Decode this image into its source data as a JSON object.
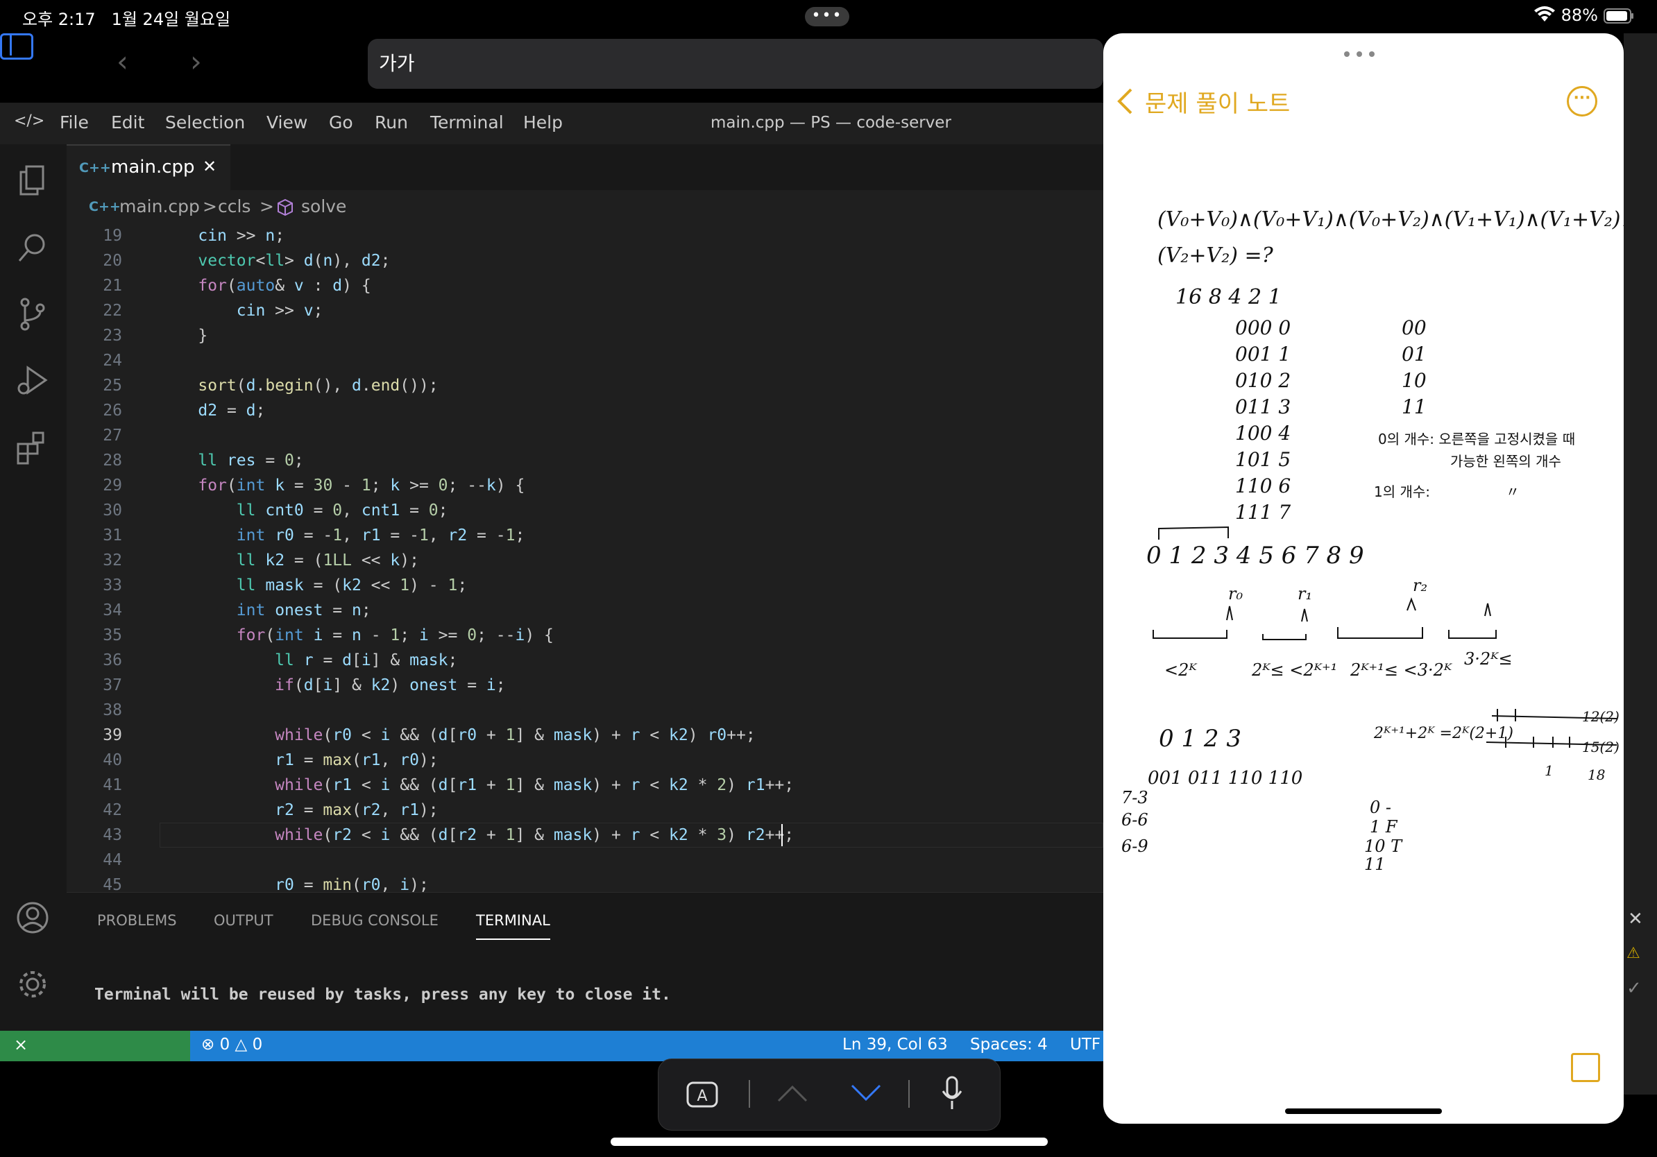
{
  "status_bar": {
    "time": "오후 2:17",
    "date": "1월 24일 월요일",
    "dots": "•••",
    "battery": "88%"
  },
  "safari": {
    "url_text": "가가"
  },
  "vscode": {
    "menu": [
      "File",
      "Edit",
      "Selection",
      "View",
      "Go",
      "Run",
      "Terminal",
      "Help"
    ],
    "window_title": "main.cpp — PS — code-server",
    "tab": {
      "badge": "C++",
      "label": "main.cpp",
      "close": "✕"
    },
    "breadcrumb": {
      "file": "main.cpp",
      "sep": ">",
      "ns": "ccls",
      "symbol": "solve"
    },
    "lines": [
      {
        "n": "19",
        "c": "    cin >> n;"
      },
      {
        "n": "20",
        "c": "    vector<ll> d(n), d2;"
      },
      {
        "n": "21",
        "c": "    for(auto& v : d) {"
      },
      {
        "n": "22",
        "c": "        cin >> v;"
      },
      {
        "n": "23",
        "c": "    }"
      },
      {
        "n": "24",
        "c": ""
      },
      {
        "n": "25",
        "c": "    sort(d.begin(), d.end());"
      },
      {
        "n": "26",
        "c": "    d2 = d;"
      },
      {
        "n": "27",
        "c": ""
      },
      {
        "n": "28",
        "c": "    ll res = 0;"
      },
      {
        "n": "29",
        "c": "    for(int k = 30 - 1; k >= 0; --k) {"
      },
      {
        "n": "30",
        "c": "        ll cnt0 = 0, cnt1 = 0;"
      },
      {
        "n": "31",
        "c": "        int r0 = -1, r1 = -1, r2 = -1;"
      },
      {
        "n": "32",
        "c": "        ll k2 = (1LL << k);"
      },
      {
        "n": "33",
        "c": "        ll mask = (k2 << 1) - 1;"
      },
      {
        "n": "34",
        "c": "        int onest = n;"
      },
      {
        "n": "35",
        "c": "        for(int i = n - 1; i >= 0; --i) {"
      },
      {
        "n": "36",
        "c": "            ll r = d[i] & mask;"
      },
      {
        "n": "37",
        "c": "            if(d[i] & k2) onest = i;"
      },
      {
        "n": "38",
        "c": ""
      },
      {
        "n": "39",
        "c": "            while(r0 < i && (d[r0 + 1] & mask) + r < k2) r0++;"
      },
      {
        "n": "40",
        "c": "            r1 = max(r1, r0);"
      },
      {
        "n": "41",
        "c": "            while(r1 < i && (d[r1 + 1] & mask) + r < k2 * 2) r1++;"
      },
      {
        "n": "42",
        "c": "            r2 = max(r2, r1);"
      },
      {
        "n": "43",
        "c": "            while(r2 < i && (d[r2 + 1] & mask) + r < k2 * 3) r2++;"
      },
      {
        "n": "44",
        "c": ""
      },
      {
        "n": "45",
        "c": "            r0 = min(r0, i);"
      }
    ],
    "panel_tabs": [
      "PROBLEMS",
      "OUTPUT",
      "DEBUG CONSOLE",
      "TERMINAL"
    ],
    "terminal_text": "Terminal will be reused by tasks, press any key to close it.",
    "status": {
      "errors": "0",
      "warnings": "0",
      "position": "Ln 39, Col 63",
      "spaces": "Spaces: 4",
      "encoding": "UTF"
    }
  },
  "notes": {
    "title": "문제 풀이 노트",
    "handwriting": {
      "eq1": "(V₀+V₀)∧(V₀+V₁)∧(V₀+V₂)∧(V₁+V₁)∧(V₁+V₂)∧",
      "eq2": "(V₂+V₂) =?",
      "pow": "16  8  4  2  1",
      "bits": [
        "000 0",
        "001 1",
        "010 2",
        "011 3",
        "100 4",
        "101 5",
        "110 6",
        "111 7"
      ],
      "pairs": [
        "00",
        "01",
        "10",
        "11"
      ],
      "note0": "0의 개수: 오른쪽을 고정시켰을 때",
      "note0b": "가능한 왼쪽의 개수",
      "note1": "1의 개수:",
      "ditto": "〃",
      "numline": "0  1  2  3  4  5  6  7  8  9",
      "rlabels": [
        "r₀",
        "r₁",
        "r₂"
      ],
      "ranges": [
        "<2ᴷ",
        "2ᴷ≤ <2ᴷ⁺¹",
        "2ᴷ⁺¹≤ <3·2ᴷ",
        "3·2ᴷ≤"
      ],
      "nums2": "0   1   2   3",
      "bits2": "001  011  110  110",
      "expr": "2ᴷ⁺¹+2ᴷ =2ᴷ(2+1)",
      "left": [
        "7-3",
        "6-6",
        "6-9"
      ],
      "bin2": [
        "0 -",
        "1 F",
        "10 T",
        "11"
      ],
      "scale": [
        "1",
        "18",
        "12(2)",
        "15(2)"
      ]
    }
  }
}
